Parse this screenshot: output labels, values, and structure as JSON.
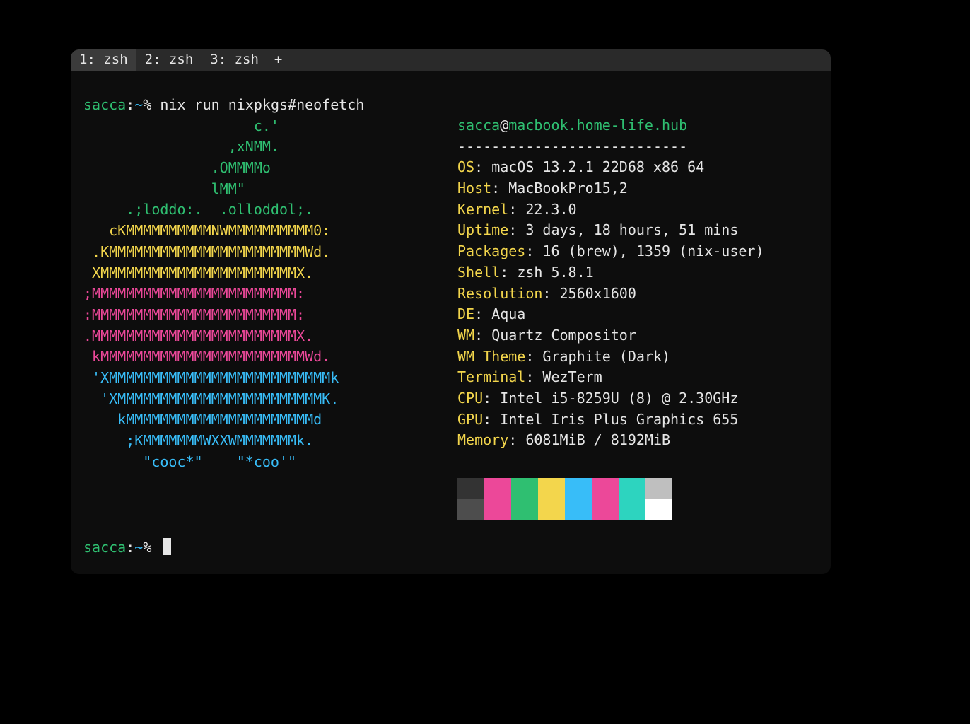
{
  "tabs": [
    "1: zsh",
    "2: zsh",
    "3: zsh"
  ],
  "new_tab_label": "+",
  "prompt": {
    "user": "sacca",
    "sep": ":",
    "path": "~",
    "sign": "%"
  },
  "command": "nix run nixpkgs#neofetch",
  "logo_lines": [
    {
      "text": "                    c.'",
      "color": "c-green"
    },
    {
      "text": "                 ,xNMM.",
      "color": "c-green"
    },
    {
      "text": "               .OMMMMo",
      "color": "c-green"
    },
    {
      "text": "               lMM\"",
      "color": "c-green"
    },
    {
      "text": "     .;loddo:.  .olloddol;.",
      "color": "c-green"
    },
    {
      "text": "   cKMMMMMMMMMMNWMMMMMMMMMM0:",
      "color": "c-yellow"
    },
    {
      "text": " .KMMMMMMMMMMMMMMMMMMMMMMMWd.",
      "color": "c-yellow"
    },
    {
      "text": " XMMMMMMMMMMMMMMMMMMMMMMMX.",
      "color": "c-yellow"
    },
    {
      "text": ";MMMMMMMMMMMMMMMMMMMMMMMM:",
      "color": "c-pink"
    },
    {
      "text": ":MMMMMMMMMMMMMMMMMMMMMMMM:",
      "color": "c-pink"
    },
    {
      "text": ".MMMMMMMMMMMMMMMMMMMMMMMMX.",
      "color": "c-pink"
    },
    {
      "text": " kMMMMMMMMMMMMMMMMMMMMMMMMWd.",
      "color": "c-pink"
    },
    {
      "text": " 'XMMMMMMMMMMMMMMMMMMMMMMMMMMk",
      "color": "c-blue"
    },
    {
      "text": "  'XMMMMMMMMMMMMMMMMMMMMMMMMK.",
      "color": "c-blue"
    },
    {
      "text": "    kMMMMMMMMMMMMMMMMMMMMMMd",
      "color": "c-blue"
    },
    {
      "text": "     ;KMMMMMMMWXXWMMMMMMMk.",
      "color": "c-blue"
    },
    {
      "text": "       \"cooc*\"    \"*coo'\"",
      "color": "c-blue"
    }
  ],
  "header_user": "sacca",
  "header_at": "@",
  "header_host": "macbook.home-life.hub",
  "header_dashes": "---------------------------",
  "info": [
    {
      "key": "OS",
      "value": "macOS 13.2.1 22D68 x86_64"
    },
    {
      "key": "Host",
      "value": "MacBookPro15,2"
    },
    {
      "key": "Kernel",
      "value": "22.3.0"
    },
    {
      "key": "Uptime",
      "value": "3 days, 18 hours, 51 mins"
    },
    {
      "key": "Packages",
      "value": "16 (brew), 1359 (nix-user)"
    },
    {
      "key": "Shell",
      "value": "zsh 5.8.1"
    },
    {
      "key": "Resolution",
      "value": "2560x1600"
    },
    {
      "key": "DE",
      "value": "Aqua"
    },
    {
      "key": "WM",
      "value": "Quartz Compositor"
    },
    {
      "key": "WM Theme",
      "value": "Graphite (Dark)"
    },
    {
      "key": "Terminal",
      "value": "WezTerm"
    },
    {
      "key": "CPU",
      "value": "Intel i5-8259U (8) @ 2.30GHz"
    },
    {
      "key": "GPU",
      "value": "Intel Iris Plus Graphics 655"
    },
    {
      "key": "Memory",
      "value": "6081MiB / 8192MiB"
    }
  ],
  "palette_row1": [
    "#333333",
    "#ec4899",
    "#2fbf71",
    "#f3d64c",
    "#38bdf8",
    "#ec4899",
    "#2dd4bf",
    "#bfbfbf"
  ],
  "palette_row2": [
    "#4d4d4d",
    "#ec4899",
    "#2fbf71",
    "#f3d64c",
    "#38bdf8",
    "#ec4899",
    "#2dd4bf",
    "#ffffff"
  ]
}
